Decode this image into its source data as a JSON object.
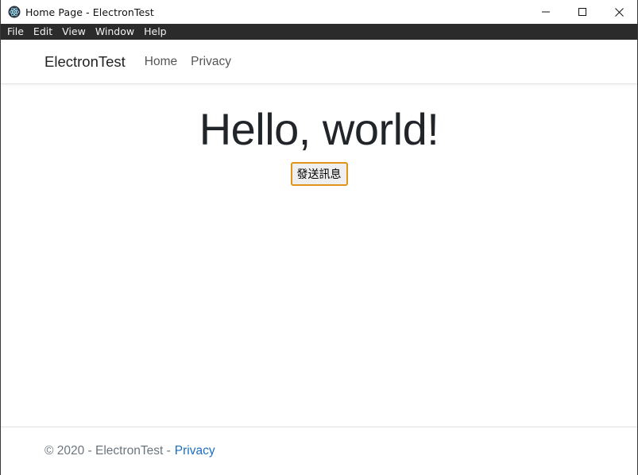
{
  "window": {
    "title": "Home Page - ElectronTest",
    "app_icon": "electron-icon",
    "controls": [
      "minimize-icon",
      "maximize-icon",
      "close-icon"
    ]
  },
  "menubar": {
    "items": [
      "File",
      "Edit",
      "View",
      "Window",
      "Help"
    ]
  },
  "navbar": {
    "brand": "ElectronTest",
    "links": [
      "Home",
      "Privacy"
    ]
  },
  "main": {
    "heading": "Hello, world!",
    "button_label": "發送訊息"
  },
  "footer": {
    "copyright": "© 2020 - ElectronTest -",
    "privacy_link": "Privacy"
  },
  "colors": {
    "menubar_bg": "#2b2b2b",
    "link": "#1b6ec2",
    "button_focus_border": "#e0951a"
  }
}
